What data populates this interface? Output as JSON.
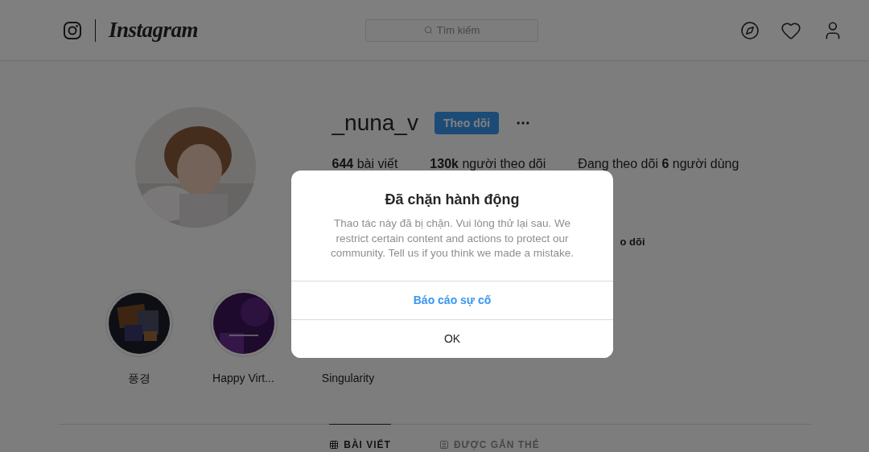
{
  "header": {
    "logo": "Instagram",
    "search": {
      "placeholder": "Tìm kiếm"
    }
  },
  "profile": {
    "username": "_nuna_v",
    "follow_button": "Theo dõi",
    "stats": [
      "**644** bài viết",
      "**130k** người theo dõi",
      "Đang theo dõi **6** người dùng"
    ],
    "partial_line": "o dõi"
  },
  "highlights": [
    {
      "label": "풍경",
      "kind": "collage"
    },
    {
      "label": "Happy Virt...",
      "kind": "purple"
    },
    {
      "label": "Singularity",
      "kind": "hidden"
    }
  ],
  "tabs": [
    {
      "label": "BÀI VIẾT",
      "kind": "grid",
      "selected": true
    },
    {
      "label": "ĐƯỢC GẮN THẺ",
      "kind": "tagged",
      "selected": false
    }
  ],
  "dialog": {
    "title": "Đã chặn hành động",
    "message": "Thao tác này đã bị chặn. Vui lòng thử lại sau. We restrict certain content and actions to protect our community. Tell us if you think we made a mistake.",
    "actions": [
      {
        "label": "Báo cáo sự cố",
        "kind": "primary"
      },
      {
        "label": "OK",
        "kind": "plain"
      }
    ]
  }
}
